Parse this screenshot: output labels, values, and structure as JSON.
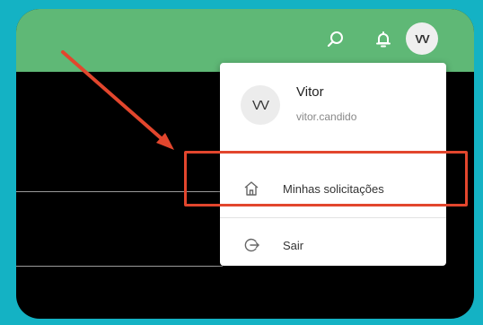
{
  "header": {
    "avatar_initials": "VV",
    "search_icon": "search-icon",
    "notification_icon": "bell-icon"
  },
  "user_menu": {
    "avatar_initials": "VV",
    "name": "Vitor",
    "login": "vitor.candido",
    "items": [
      {
        "label": "Minhas solicitações",
        "icon": "home-icon"
      },
      {
        "label": "Sair",
        "icon": "logout-icon"
      }
    ]
  },
  "annotation": {
    "color": "#e2462d",
    "target": "Minhas solicitações"
  },
  "colors": {
    "background": "#14b2c4",
    "header": "#5fb876",
    "content": "#000000",
    "menu": "#ffffff"
  }
}
